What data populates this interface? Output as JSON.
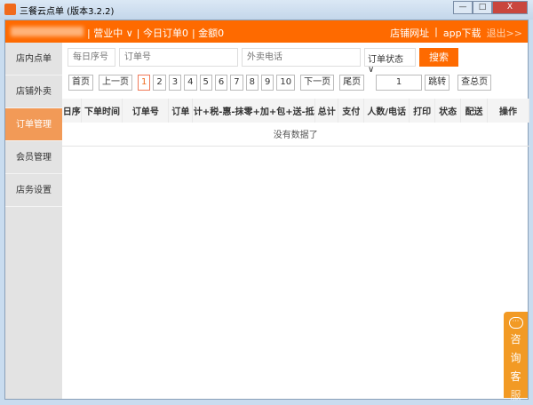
{
  "window": {
    "title": "三餐云点单 (版本3.2.2)",
    "minimize": "—",
    "maximize": "□",
    "close": "X"
  },
  "topbar": {
    "status": "| 营业中 ∨",
    "today_orders": "| 今日订单0",
    "amount": "| 金额0",
    "shop_url": "店铺网址",
    "sep": "|",
    "app_download": "app下载",
    "logout": "退出>>"
  },
  "sidebar": {
    "items": [
      {
        "label": "店内点单"
      },
      {
        "label": "店铺外卖"
      },
      {
        "label": "订单管理",
        "active": true
      },
      {
        "label": "会员管理"
      },
      {
        "label": "店务设置"
      }
    ]
  },
  "search": {
    "daily_seq_placeholder": "每日序号",
    "order_no_placeholder": "订单号",
    "phone_placeholder": "外卖电话",
    "status_select": "订单状态 ∨",
    "search_button": "搜索"
  },
  "pager": {
    "first": "首页",
    "prev": "上一页",
    "pages": [
      "1",
      "2",
      "3",
      "4",
      "5",
      "6",
      "7",
      "8",
      "9",
      "10"
    ],
    "current": "1",
    "next": "下一页",
    "last": "尾页",
    "page_input": "1",
    "jump": "跳转",
    "total": "查总页"
  },
  "table": {
    "headers": [
      "日序",
      "下单时间",
      "订单号",
      "订单",
      "计+税-惠-抹零+加+包+送-抵",
      "总计",
      "支付",
      "人数/电话",
      "打印",
      "状态",
      "配送",
      "操作"
    ],
    "empty": "没有数据了"
  },
  "consult": {
    "label": [
      "咨",
      "询",
      "客",
      "服"
    ]
  },
  "colors": {
    "accent": "#fe6a00",
    "sidebar_active": "#f29a57",
    "consult": "#f29a24"
  }
}
